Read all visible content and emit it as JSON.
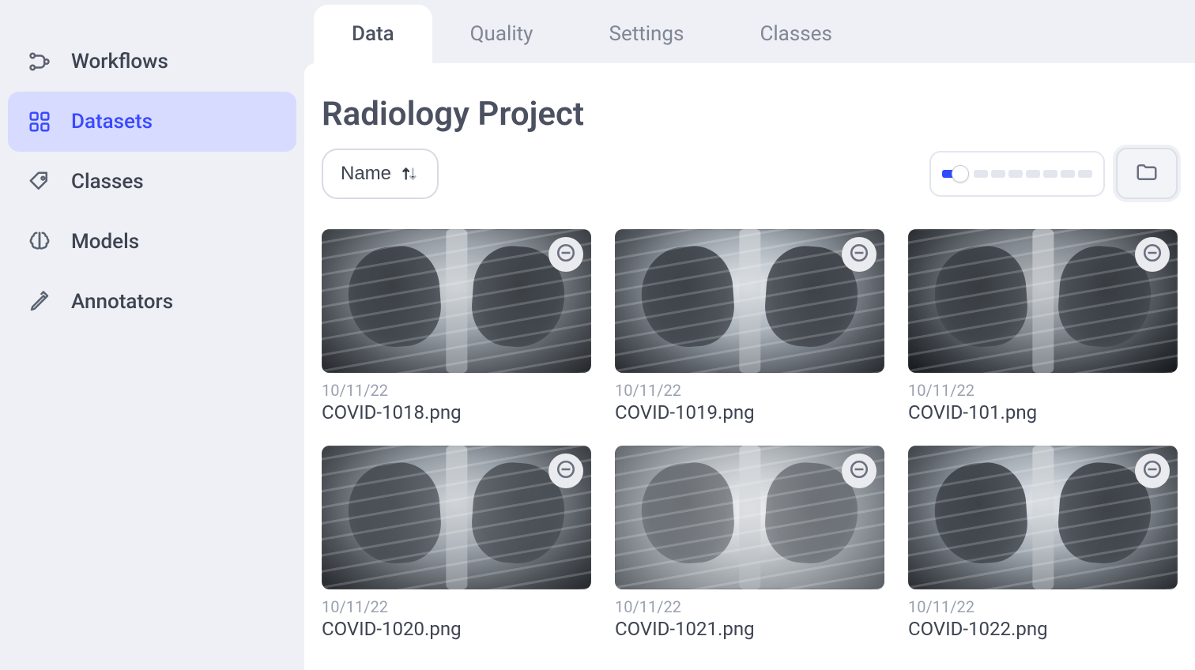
{
  "sidebar": {
    "items": [
      {
        "label": "Workflows",
        "icon": "workflow-icon",
        "active": false
      },
      {
        "label": "Datasets",
        "icon": "datasets-icon",
        "active": true
      },
      {
        "label": "Classes",
        "icon": "tag-icon",
        "active": false
      },
      {
        "label": "Models",
        "icon": "brain-icon",
        "active": false
      },
      {
        "label": "Annotators",
        "icon": "pen-icon",
        "active": false
      }
    ]
  },
  "tabs": [
    {
      "label": "Data",
      "active": true
    },
    {
      "label": "Quality",
      "active": false
    },
    {
      "label": "Settings",
      "active": false
    },
    {
      "label": "Classes",
      "active": false
    }
  ],
  "page": {
    "title": "Radiology Project",
    "sort_label": "Name"
  },
  "toolbar": {
    "zoom_segments": 8,
    "zoom_level": 1
  },
  "items": [
    {
      "date": "10/11/22",
      "name": "COVID-1018.png"
    },
    {
      "date": "10/11/22",
      "name": "COVID-1019.png"
    },
    {
      "date": "10/11/22",
      "name": "COVID-101.png"
    },
    {
      "date": "10/11/22",
      "name": "COVID-1020.png"
    },
    {
      "date": "10/11/22",
      "name": "COVID-1021.png"
    },
    {
      "date": "10/11/22",
      "name": "COVID-1022.png"
    }
  ]
}
